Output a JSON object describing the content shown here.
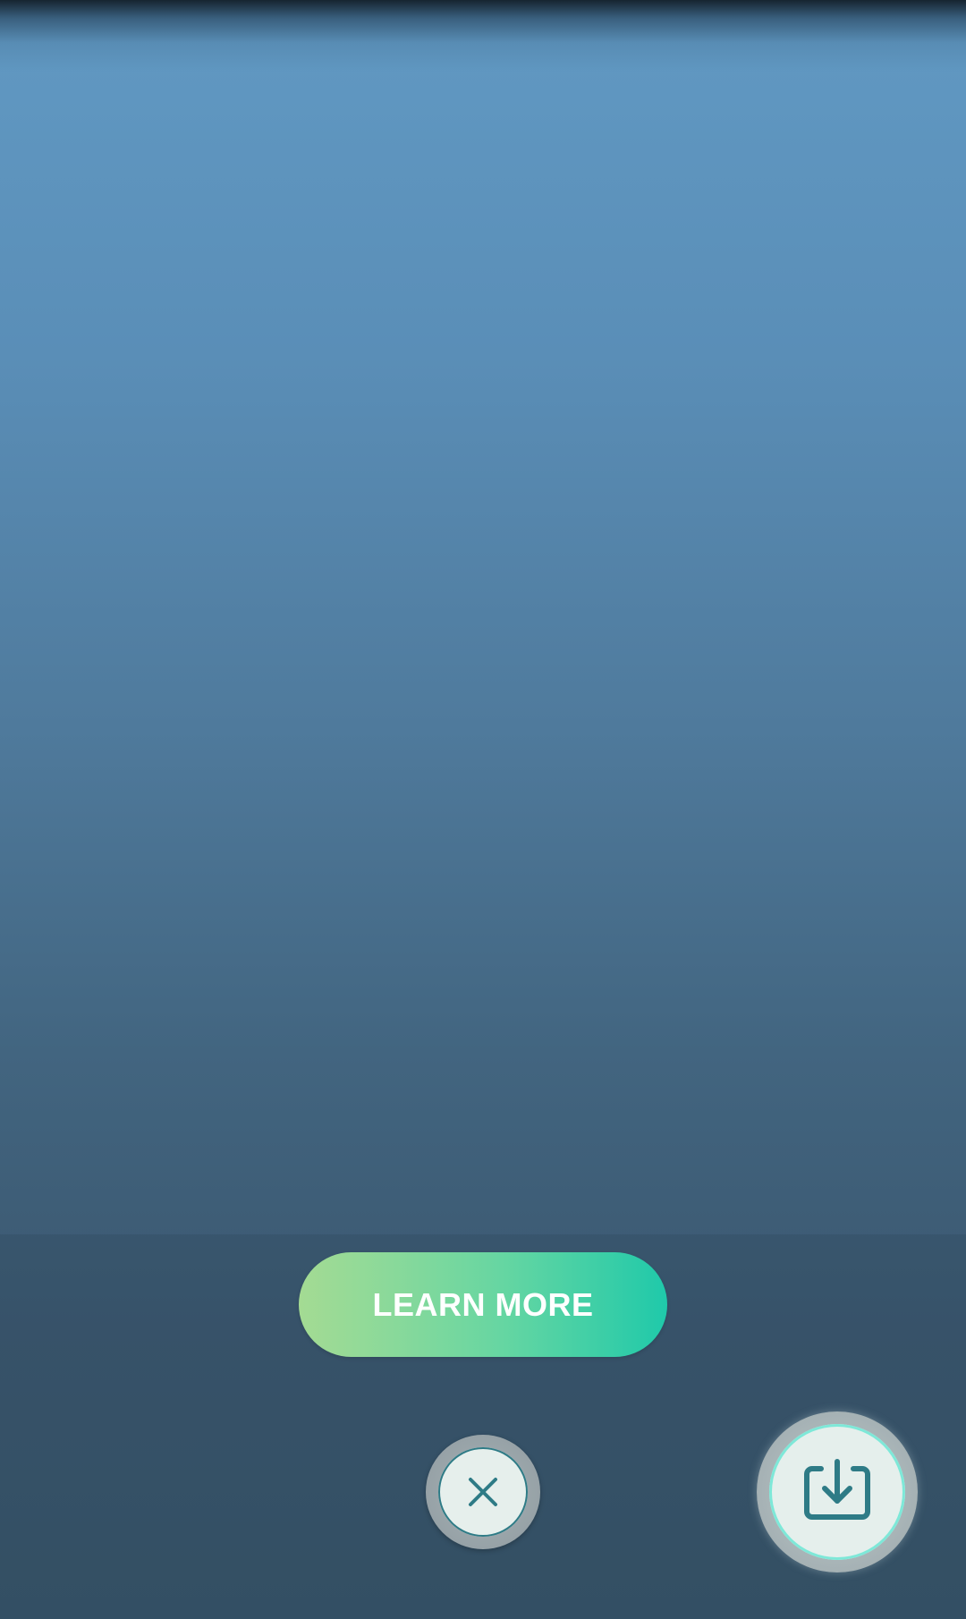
{
  "main": {
    "learn_more_label": "LEARN MORE"
  },
  "controls": {
    "close_icon": "close-icon",
    "save_icon": "download-icon"
  },
  "colors": {
    "background_top": "#6199c3",
    "background_bottom": "#375469",
    "button_gradient_start": "#a4db93",
    "button_gradient_end": "#1fc9aa",
    "icon_teal": "#2e7b86"
  }
}
